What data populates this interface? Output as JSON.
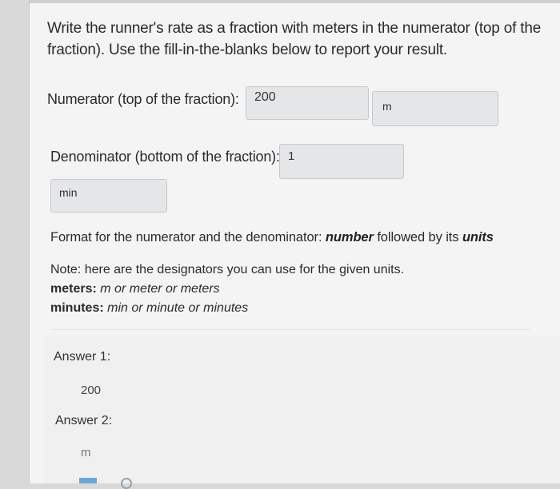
{
  "question": {
    "instructions": "Write the runner's rate as a fraction with meters in the numerator (top of the fraction). Use the fill-in-the-blanks below to report your result."
  },
  "numerator": {
    "label": "Numerator (top of the fraction):",
    "value_blank": "200",
    "unit_blank": "m"
  },
  "denominator": {
    "label": "Denominator (bottom of the fraction):",
    "value_blank": "1",
    "unit_blank": "min"
  },
  "format": {
    "prefix": "Format for the numerator and the denominator:",
    "number": "number",
    "middle": "followed by its",
    "units": "units"
  },
  "note": {
    "heading": "Note: here are the designators you can use for the given units.",
    "meters_label": "meters:",
    "meters_values": "m or meter or meters",
    "minutes_label": "minutes:",
    "minutes_values": "min or minute or minutes"
  },
  "answers": {
    "answer1_label": "Answer 1:",
    "answer1_value": "200",
    "answer2_label": "Answer 2:",
    "answer2_value": "m"
  }
}
